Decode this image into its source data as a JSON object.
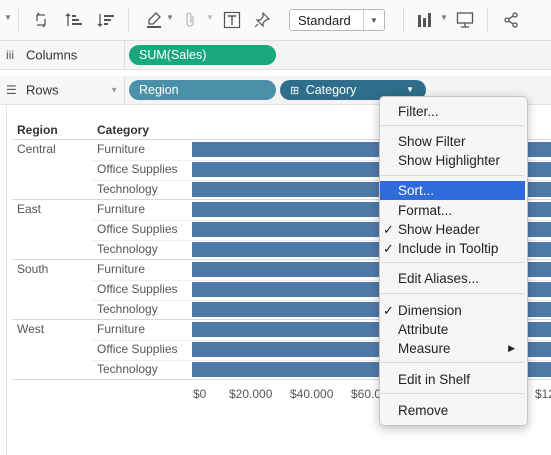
{
  "toolbar": {
    "mark_type_select": "Standard",
    "icons": [
      "dropdown-caret",
      "swap-icon",
      "sort-ascending-icon",
      "sort-descending-icon",
      "highlighter-icon",
      "paperclip-icon",
      "text-label-icon",
      "pin-icon",
      "bar-chart-icon",
      "presentation-icon",
      "share-icon"
    ]
  },
  "shelves": {
    "columns_label": "Columns",
    "columns_pill": "SUM(Sales)",
    "rows_label": "Rows",
    "rows_pill_1": "Region",
    "rows_pill_2": "Category",
    "rows_pill_2_prefix": "⊞"
  },
  "view": {
    "header_region": "Region",
    "header_category": "Category",
    "regions": [
      "Central",
      "East",
      "South",
      "West"
    ],
    "categories": [
      "Furniture",
      "Office Supplies",
      "Technology"
    ],
    "axis_ticks": [
      "$0",
      "$20.000",
      "$40.000",
      "$60.0",
      "$12"
    ]
  },
  "menu": {
    "items": [
      {
        "label": "Filter...",
        "checked": false
      },
      {
        "label": "Show Filter",
        "checked": false
      },
      {
        "label": "Show Highlighter",
        "checked": false
      },
      {
        "label": "Sort...",
        "checked": false,
        "highlighted": true
      },
      {
        "label": "Format...",
        "checked": false
      },
      {
        "label": "Show Header",
        "checked": true
      },
      {
        "label": "Include in Tooltip",
        "checked": true
      },
      {
        "label": "Edit Aliases...",
        "checked": false
      },
      {
        "label": "Dimension",
        "checked": true
      },
      {
        "label": "Attribute",
        "checked": false
      },
      {
        "label": "Measure",
        "checked": false,
        "submenu": true
      },
      {
        "label": "Edit in Shelf",
        "checked": false
      },
      {
        "label": "Remove",
        "checked": false
      }
    ],
    "check_glyph": "✓",
    "submenu_glyph": "▶"
  },
  "colors": {
    "bar": "#4e79a7",
    "measure_pill": "#18a87e",
    "dimension_pill": "#4a90a9",
    "highlight": "#2f6bdb"
  }
}
